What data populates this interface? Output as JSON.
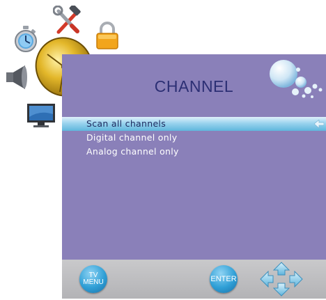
{
  "panel": {
    "title": "CHANNEL"
  },
  "menu": {
    "items": [
      {
        "label": "Scan all channels",
        "selected": true
      },
      {
        "label": "Digital channel only",
        "selected": false
      },
      {
        "label": "Analog channel only",
        "selected": false
      }
    ]
  },
  "bottom_bar": {
    "tv_menu_label_line1": "TV",
    "tv_menu_label_line2": "MENU",
    "enter_label": "ENTER"
  },
  "side_icons": [
    "stopwatch-icon",
    "tools-icon",
    "lock-icon",
    "speaker-icon",
    "satellite-dish-icon",
    "monitor-icon"
  ],
  "colors": {
    "panel_bg": "#8a80b9",
    "title": "#2c2f74",
    "highlight": "#9ad3ee",
    "button_blue": "#2f9fd6",
    "bottom_bar": "#c0c0c2"
  }
}
